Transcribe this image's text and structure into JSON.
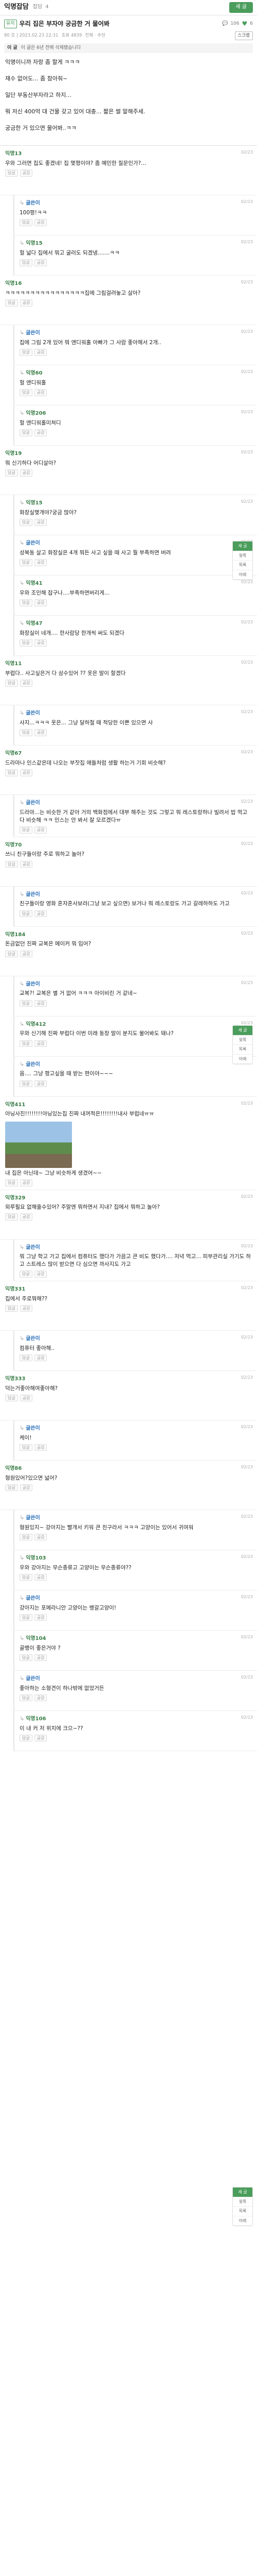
{
  "header": {
    "board": "익명잡담",
    "menu": "잡담",
    "menu2": "4",
    "write": "새 글"
  },
  "post": {
    "tag": "유저",
    "title": "우리 집은 부자야 궁금한 거 물어봐",
    "comment_count": "106",
    "likes": "6",
    "meta_date": "80 조 | 2023.02.23 22:31",
    "meta_views": "조회 4839",
    "meta_more": "전체 · 추천",
    "scrap": "스크랩",
    "notice_tag": "이 글",
    "notice": "이 글은 6년 전에 삭제됐습니다",
    "body": [
      "익명이니까 자랑 좀 할게 ㅋㅋㅋ",
      "재수 없어도... 좀 참아줘~",
      "일단 부동산부자라고 하지...",
      "뭐 저신 400억 대 건물 갖고 있어 대충... 짧은 썰 말해주세.",
      "궁금한 거 있으면 물어봐..ㅋㅋ"
    ]
  },
  "side_nav": {
    "top": "새 글",
    "up": "윗쪽",
    "list": "목록",
    "down": "아래"
  },
  "comments": [
    {
      "author": "익명13",
      "time": "02/23",
      "text": "우와 그러면 집도 좋겠네! 집 몇평이야? 좀 예민한 질문인가?...",
      "reply": false
    },
    {
      "author": "글쓴이",
      "time": "02/23",
      "text": "100평!ㅋㅋ",
      "reply": true,
      "op": true
    },
    {
      "author": "익명15",
      "time": "02/23",
      "text": "헐 넓다 집에서 뭐고 굴러도 되겠넹.......ㅋㅋ",
      "reply": true
    },
    {
      "author": "익명16",
      "time": "02/23",
      "text": "ㅋㅋㅋㅋㅋㅋㅋㅋㅋㅋㅋㅋㅋㅋㅋㅋ집에 그림걸려놓고 살아?",
      "reply": false
    },
    {
      "author": "글쓴이",
      "time": "02/23",
      "text": "집에 그림 2개 있어 뭐 앤디워홀 아빠가 그 사람 좋아해서 2개..",
      "reply": true,
      "op": true
    },
    {
      "author": "익명60",
      "time": "02/23",
      "text": "헐 앤디워홀",
      "reply": true
    },
    {
      "author": "익명206",
      "time": "02/23",
      "text": "헐 앤디워홀미쳐디",
      "reply": true
    },
    {
      "author": "익명19",
      "time": "02/23",
      "text": "뭐 신기하다 어디살아?",
      "reply": false
    },
    {
      "author": "익명15",
      "time": "02/23",
      "text": "화장실몇개야?궁금 많아?",
      "reply": true
    },
    {
      "author": "글쓴이",
      "time": "02/23",
      "text": "성북동 살고 화장실은 4개 뭐든 사고 싶을 때 사고 뭘 부족하면 버려",
      "reply": true,
      "op": true
    },
    {
      "author": "익명41",
      "time": "02/23",
      "text": "우와 조인해 잡구나....부족하면버리게...",
      "reply": true
    },
    {
      "author": "익명47",
      "time": "02/23",
      "text": "화장실이 네개.... 한사람당 한개씩 써도 되겠다",
      "reply": true
    },
    {
      "author": "익명11",
      "time": "02/23",
      "text": "부럽다.. 사고싶은거 다 삼수있어 ?? 옷은 말이 할겠다",
      "reply": false
    },
    {
      "author": "글쓴이",
      "time": "02/23",
      "text": "사지...ㅋㅋㅋ 옷은... 그냥 달하철 때 적당한 이쁜 있으면 사",
      "reply": true,
      "op": true
    },
    {
      "author": "익명67",
      "time": "02/23",
      "text": "드라마나 인스같은데 나오는 부잣집 애들처럼 생활 하는거 기회 비슷해?",
      "reply": false
    },
    {
      "author": "글쓴이",
      "time": "02/23",
      "text": "드라마...는 비슷한 거 같아 거의 백화점에서 대부 해주는 것도 그렇고 뭐 레스토랑하나 빌려서 밥 먹고 다 비슷해 ㅋㅋ 인스는 안 봐서 잘 모르겠다ㅠ",
      "reply": true,
      "op": true
    },
    {
      "author": "익명70",
      "time": "02/23",
      "text": "쓰니 친구들이랑 주로 뭐하고 놀아?",
      "reply": false
    },
    {
      "author": "글쓴이",
      "time": "02/23",
      "text": "친구들이랑 영화 혼자혼사보러(그냥 보고 싶으면) 보거나 뭐 레스토랑도 가고 갈레하하도 가고",
      "reply": true,
      "op": true
    },
    {
      "author": "익명184",
      "time": "02/23",
      "text": "돈금없던 진짜 교복은 메이커 뭐 입어?",
      "reply": false
    },
    {
      "author": "글쓴이",
      "time": "02/23",
      "text": "교복?! 교복은 별 거 없어 ㅋㅋㅋ 아이비린 거 같네~",
      "reply": true,
      "op": true
    },
    {
      "author": "익명412",
      "time": "02/23",
      "text": "우와 신기해 진짜 부럽다 이번 미래 동창 말이 분지도 물어봐도 돼나?",
      "reply": true
    },
    {
      "author": "글쓴이",
      "time": "02/23",
      "text": "음.... 그냥 평고싶을 때 받는 편이야~~~",
      "reply": true,
      "op": true
    },
    {
      "author": "익명411",
      "time": "02/23",
      "text": "아닝사진!!!!!!!!아닝있는집 진짜 내꺼적은!!!!!!!!내사 부럽네ㅠㅠ",
      "reply": false,
      "image": true,
      "image_caption": "내 집은 아닌데~ 그냥 비슷하게 생겼어~~"
    },
    {
      "author": "익명329",
      "time": "02/23",
      "text": "외루필요 없해줄수있어? 주말엔 뭐하면서 지내?  집에서 뭐하고 놀아?",
      "reply": false
    },
    {
      "author": "글쓴이",
      "time": "02/23",
      "text": "뭐 그냥 학고 가고 집에서 컴퓨터도 했다가 가끔고 큰 비도 했다가.... 저녁 먹고... 피부관리실 가기도 하고 스트레스 많이 받으면 다 심으면 까사지도 가고",
      "reply": true,
      "op": true
    },
    {
      "author": "익명331",
      "time": "02/23",
      "text": "집에서 주로뭐해??",
      "reply": false
    },
    {
      "author": "글쓴이",
      "time": "02/23",
      "text": "컴퓨터 좋아해..",
      "reply": true,
      "op": true
    },
    {
      "author": "익명333",
      "time": "02/23",
      "text": "덕는거좋아해여좋아해?",
      "reply": false
    },
    {
      "author": "글쓴이",
      "time": "02/23",
      "text": "케이!",
      "reply": true,
      "op": true
    },
    {
      "author": "익명86",
      "time": "02/23",
      "text": "형원있어?있으면 넓어?",
      "reply": false
    },
    {
      "author": "글쓴이",
      "time": "02/23",
      "text": "형원있지~ 강아지는 빨개서 키워 큰 친구라서 ㅋㅋㅋ 고양이는 있어서 귀여워",
      "reply": true,
      "op": true
    },
    {
      "author": "익명103",
      "time": "02/23",
      "text": "우와 강아지는 무슨종류고 고양이는 무슨종류야??",
      "reply": true
    },
    {
      "author": "글쓴이",
      "time": "02/23",
      "text": "강아지는 포메라니안 고양이는 뱅갈고양이!",
      "reply": true,
      "op": true
    },
    {
      "author": "익명104",
      "time": "02/23",
      "text": "골뱅이 좋은거야 ?",
      "reply": true
    },
    {
      "author": "글쓴이",
      "time": "02/23",
      "text": "좋아하는 소형견이 하나밖에 없었거든",
      "reply": true,
      "op": true
    },
    {
      "author": "익명106",
      "time": "02/23",
      "text": "이 내 커 저 위치에 크으~??",
      "reply": true
    }
  ],
  "labels": {
    "reply_btn": "답글",
    "like_btn": "공감"
  }
}
